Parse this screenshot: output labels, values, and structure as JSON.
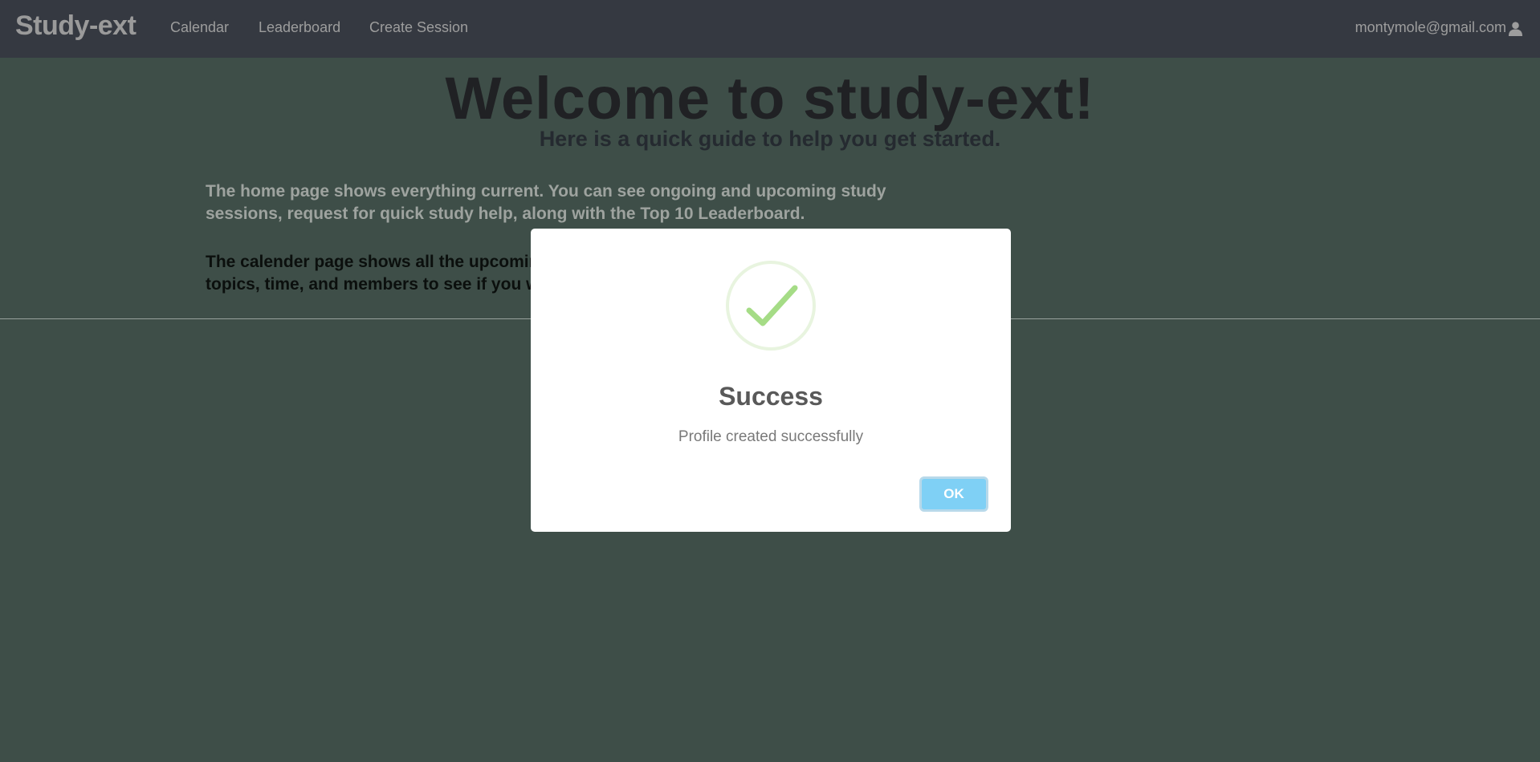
{
  "navbar": {
    "brand": "Study-ext",
    "links": {
      "calendar": "Calendar",
      "leaderboard": "Leaderboard",
      "create_session": "Create Session"
    },
    "user_email": "montymole@gmail.com",
    "user_icon": "user-icon"
  },
  "main": {
    "title": "Welcome to study-ext!",
    "subtitle": "Here is a quick guide to help you get started.",
    "paragraph_home": "The home page shows everything current. You can see ongoing and upcoming study sessions, request for quick study help, along with the Top 10 Leaderboard.",
    "paragraph_calendar_fragments": {
      "line1": "The calender page shows all the upcomin",
      "line2": "topics, time, and members to see if you w"
    }
  },
  "modal": {
    "icon": "success-check-icon",
    "title": "Success",
    "message": "Profile created successfully",
    "ok_label": "OK"
  },
  "colors": {
    "navbar_bg": "#353941",
    "page_overlay": "#3e4e48",
    "ok_button": "#7fd0f5",
    "success_green": "#a5dc86"
  }
}
